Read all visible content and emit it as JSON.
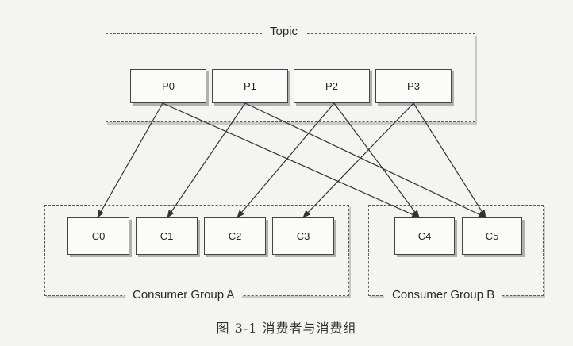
{
  "topic": {
    "label": "Topic",
    "partitions": [
      "P0",
      "P1",
      "P2",
      "P3"
    ]
  },
  "group_a": {
    "label": "Consumer Group  A",
    "consumers": [
      "C0",
      "C1",
      "C2",
      "C3"
    ]
  },
  "group_b": {
    "label": "Consumer Group  B",
    "consumers": [
      "C4",
      "C5"
    ]
  },
  "assignments": [
    {
      "from": "P0",
      "to": "C0"
    },
    {
      "from": "P0",
      "to": "C4"
    },
    {
      "from": "P1",
      "to": "C1"
    },
    {
      "from": "P1",
      "to": "C5"
    },
    {
      "from": "P2",
      "to": "C2"
    },
    {
      "from": "P2",
      "to": "C4"
    },
    {
      "from": "P3",
      "to": "C3"
    },
    {
      "from": "P3",
      "to": "C5"
    }
  ],
  "caption": "图 3-1   消费者与消费组"
}
